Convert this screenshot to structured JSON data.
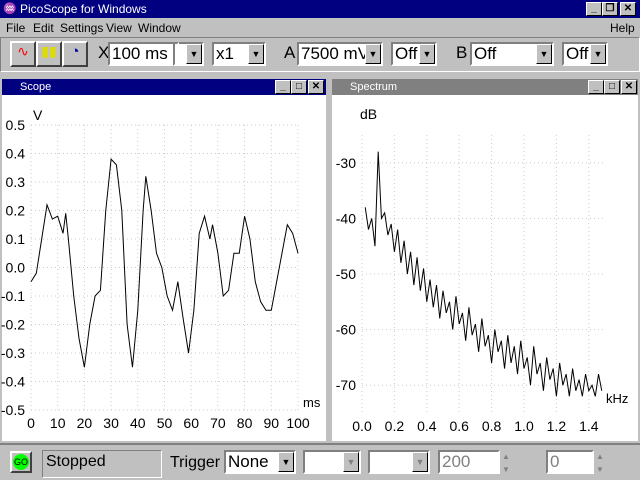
{
  "app": {
    "title": "PicoScope for Windows"
  },
  "menu": {
    "file": "File",
    "edit": "Edit",
    "settings": "Settings",
    "view": "View",
    "window": "Window",
    "help": "Help"
  },
  "toolbar": {
    "x_label": "X",
    "timebase": "100 ms",
    "multiplier": "x1",
    "a_label": "A",
    "a_range": "7500 mV",
    "a_coupling": "Off",
    "b_label": "B",
    "b_range": "Off",
    "b_coupling": "Off"
  },
  "scope": {
    "title": "Scope"
  },
  "spectrum": {
    "title": "Spectrum"
  },
  "status": {
    "go": "GO",
    "state": "Stopped",
    "trigger_label": "Trigger",
    "trigger_mode": "None",
    "delay": "200",
    "level": "0"
  },
  "chart_data": [
    {
      "type": "line",
      "title": "Scope",
      "ylabel": "V",
      "xlabel": "ms",
      "xlim": [
        0,
        100
      ],
      "ylim": [
        -0.5,
        0.5
      ],
      "xticks": [
        "0",
        "10",
        "20",
        "30",
        "40",
        "50",
        "60",
        "70",
        "80",
        "90",
        "100"
      ],
      "yticks": [
        "0.5",
        "0.4",
        "0.3",
        "0.2",
        "0.1",
        "0.0",
        "-0.1",
        "-0.2",
        "-0.3",
        "-0.4",
        "-0.5"
      ],
      "x": [
        0,
        2,
        4,
        6,
        8,
        10,
        12,
        13,
        14,
        16,
        18,
        20,
        22,
        24,
        26,
        28,
        30,
        32,
        34,
        36,
        38,
        40,
        42,
        43,
        45,
        47,
        49,
        51,
        53,
        55,
        57,
        59,
        61,
        63,
        65,
        67,
        68,
        70,
        72,
        74,
        76,
        78,
        80,
        82,
        84,
        86,
        88,
        90,
        92,
        94,
        96,
        98,
        100
      ],
      "y": [
        -0.05,
        -0.02,
        0.1,
        0.22,
        0.17,
        0.18,
        0.12,
        0.19,
        0.1,
        -0.1,
        -0.25,
        -0.35,
        -0.2,
        -0.1,
        -0.08,
        0.2,
        0.38,
        0.36,
        0.2,
        -0.2,
        -0.35,
        -0.15,
        0.2,
        0.32,
        0.2,
        0.05,
        0.0,
        -0.1,
        -0.15,
        -0.05,
        -0.18,
        -0.3,
        -0.15,
        0.12,
        0.18,
        0.1,
        0.15,
        0.05,
        -0.1,
        -0.08,
        0.05,
        0.05,
        0.18,
        0.1,
        -0.05,
        -0.12,
        -0.15,
        -0.15,
        -0.05,
        0.05,
        0.15,
        0.12,
        0.05
      ]
    },
    {
      "type": "line",
      "title": "Spectrum",
      "ylabel": "dB",
      "xlabel": "kHz",
      "xlim": [
        0,
        1.5
      ],
      "ylim": [
        -75,
        -25
      ],
      "xticks": [
        "0.0",
        "0.2",
        "0.4",
        "0.6",
        "0.8",
        "1.0",
        "1.2",
        "1.4"
      ],
      "yticks": [
        "-30",
        "-40",
        "-50",
        "-60",
        "-70"
      ],
      "x_start": 0.02,
      "x_step": 0.02,
      "y": [
        -38,
        -42,
        -40,
        -45,
        -28,
        -40,
        -39,
        -43,
        -41,
        -46,
        -42,
        -48,
        -44,
        -50,
        -46,
        -52,
        -47,
        -53,
        -49,
        -55,
        -51,
        -56,
        -52,
        -58,
        -53,
        -57,
        -55,
        -60,
        -54,
        -59,
        -57,
        -62,
        -56,
        -61,
        -59,
        -64,
        -58,
        -63,
        -61,
        -66,
        -60,
        -64,
        -62,
        -67,
        -61,
        -66,
        -63,
        -68,
        -62,
        -67,
        -65,
        -70,
        -63,
        -68,
        -66,
        -71,
        -65,
        -69,
        -67,
        -72,
        -66,
        -70,
        -68,
        -72,
        -67,
        -71,
        -69,
        -72,
        -68,
        -71,
        -70,
        -72,
        -68,
        -71
      ]
    }
  ]
}
